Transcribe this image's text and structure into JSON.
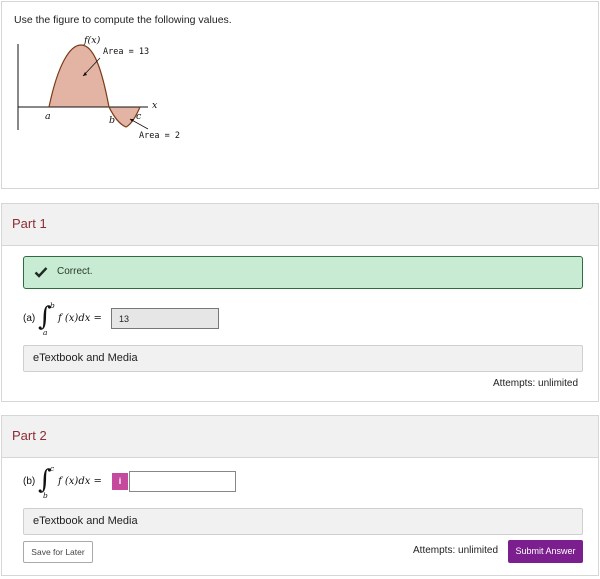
{
  "question": {
    "prompt": "Use the figure to compute the following values.",
    "figure": {
      "function_label": "f(x)",
      "area_top_label": "Area = 13",
      "area_bottom_label": "Area = 2",
      "x_label": "x",
      "a_label": "a",
      "b_label": "b",
      "c_label": "c",
      "colors": {
        "fill": "#e3b3a3",
        "stroke": "#7a3b1a"
      }
    }
  },
  "part1": {
    "title": "Part 1",
    "status": "Correct.",
    "question_label": "(a)",
    "integral": {
      "upper": "b",
      "lower": "a",
      "integrand": "f (x)dx ="
    },
    "answer_value": "13",
    "media_label": "eTextbook and Media",
    "attempts": "Attempts: unlimited"
  },
  "part2": {
    "title": "Part 2",
    "question_label": "(b)",
    "integral": {
      "upper": "c",
      "lower": "b",
      "integrand": "f (x)dx ="
    },
    "info_icon": "i",
    "answer_value": "",
    "media_label": "eTextbook and Media",
    "save_label": "Save for Later",
    "attempts": "Attempts: unlimited",
    "submit_label": "Submit Answer"
  },
  "colors": {
    "part_title": "#8c2c34",
    "correct_bg": "#c7ebd3",
    "submit_bg": "#7a1f8d",
    "info_bg": "#c54a9e"
  }
}
